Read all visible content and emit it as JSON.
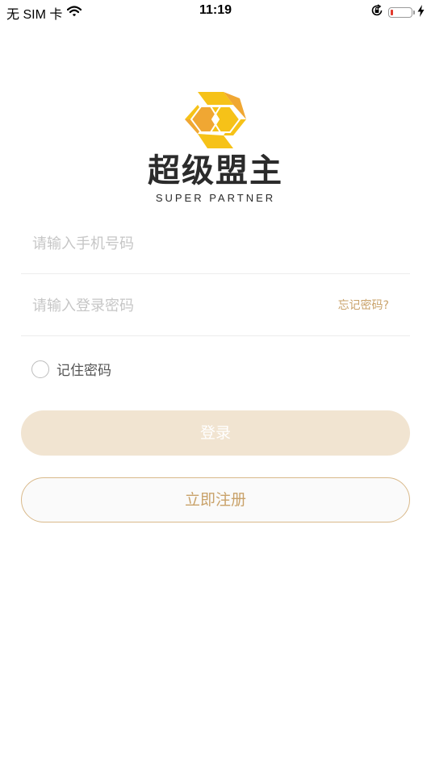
{
  "status_bar": {
    "carrier": "无 SIM 卡",
    "time": "11:19",
    "battery_color": "#e23b2e"
  },
  "logo": {
    "name": "超级盟主",
    "subtitle": "SUPER PARTNER",
    "colors": [
      "#f6c218",
      "#f0a733"
    ]
  },
  "form": {
    "phone_placeholder": "请输入手机号码",
    "password_placeholder": "请输入登录密码",
    "forgot_label": "忘记密码?",
    "remember_label": "记住密码",
    "remember_checked": false
  },
  "buttons": {
    "login_label": "登录",
    "register_label": "立即注册"
  },
  "accent_color": "#c9a26a"
}
